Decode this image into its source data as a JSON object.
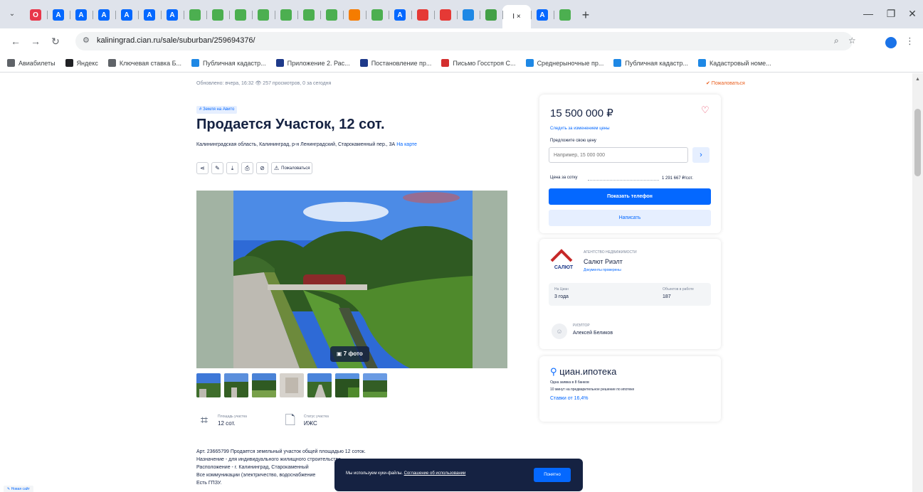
{
  "browser": {
    "tabs": [
      {
        "icon": "opera-icon",
        "letter": "O",
        "color": "#e8364a"
      },
      {
        "icon": "cian-tab-icon",
        "letter": "A",
        "color": "#0468ff"
      },
      {
        "icon": "cian-tab-icon",
        "letter": "A",
        "color": "#0468ff"
      },
      {
        "icon": "cian-tab-icon",
        "letter": "A",
        "color": "#0468ff"
      },
      {
        "icon": "cian-tab-icon",
        "letter": "A",
        "color": "#0468ff"
      },
      {
        "icon": "cian-tab-icon",
        "letter": "A",
        "color": "#0468ff"
      },
      {
        "icon": "cian-tab-icon",
        "letter": "A",
        "color": "#0468ff"
      },
      {
        "icon": "map-tab-icon",
        "letter": "",
        "color": "#4caf50"
      },
      {
        "icon": "map-tab-icon",
        "letter": "",
        "color": "#4caf50"
      },
      {
        "icon": "map-tab-icon",
        "letter": "",
        "color": "#4caf50"
      },
      {
        "icon": "map-tab-icon",
        "letter": "",
        "color": "#4caf50"
      },
      {
        "icon": "map-tab-icon",
        "letter": "",
        "color": "#4caf50"
      },
      {
        "icon": "map-tab-icon",
        "letter": "",
        "color": "#4caf50"
      },
      {
        "icon": "map-tab-icon",
        "letter": "",
        "color": "#4caf50"
      },
      {
        "icon": "orange-tab-icon",
        "letter": "",
        "color": "#f57c00"
      },
      {
        "icon": "map-tab-icon",
        "letter": "",
        "color": "#4caf50"
      },
      {
        "icon": "cian-tab-icon",
        "letter": "A",
        "color": "#0468ff"
      },
      {
        "icon": "flag-tab-icon",
        "letter": "",
        "color": "#e53935"
      },
      {
        "icon": "flag-tab-icon",
        "letter": "",
        "color": "#e53935"
      },
      {
        "icon": "sheet-tab-icon",
        "letter": "",
        "color": "#1e88e5"
      },
      {
        "icon": "green-check-tab-icon",
        "letter": "",
        "color": "#43a047"
      }
    ],
    "active_tab": {
      "label": "I",
      "close": "×"
    },
    "after_tabs": [
      {
        "icon": "cian-tab-icon",
        "letter": "A",
        "color": "#0468ff"
      },
      {
        "icon": "map-tab-icon",
        "letter": "",
        "color": "#4caf50"
      }
    ],
    "url": "kaliningrad.cian.ru/sale/suburban/259694376/",
    "bookmarks": [
      {
        "label": "Авиабилеты",
        "icon": "globe-icon",
        "color": "#5f6368"
      },
      {
        "label": "Яндекс",
        "icon": "yandex-icon",
        "color": "#202124"
      },
      {
        "label": "Ключевая ставка Б...",
        "icon": "bank-icon",
        "color": "#5f6368"
      },
      {
        "label": "Публичная кадастр...",
        "icon": "map-bookmark-icon",
        "color": "#1e88e5"
      },
      {
        "label": "Приложение 2. Рас...",
        "icon": "doc-icon",
        "color": "#1e3a8a"
      },
      {
        "label": "Постановление пр...",
        "icon": "doc-icon",
        "color": "#1e3a8a"
      },
      {
        "label": "Письмо Госстроя С...",
        "icon": "star-bookmark-icon",
        "color": "#d32f2f"
      },
      {
        "label": "Среднерыночные пр...",
        "icon": "gear-bookmark-icon",
        "color": "#1e88e5"
      },
      {
        "label": "Публичная кадастр...",
        "icon": "folder-icon",
        "color": "#1e88e5"
      },
      {
        "label": "Кадастровый номе...",
        "icon": "check-bookmark-icon",
        "color": "#1e88e5"
      }
    ]
  },
  "listing": {
    "meta": "Обновлено: вчера, 16:32   👁 257 просмотров, 0 за сегодня",
    "complaint": "✔ Пожаловаться",
    "badge": "# Земля на Авито",
    "title": "Продается Участок, 12 сот.",
    "address": "Калининградская область, Калининград, р-н Ленинградский, Старокаменный пер., 3А",
    "address_link": "На карте",
    "actions_label": "Пожаловаться",
    "photo_button": "▣ 7 фото",
    "props": [
      {
        "label": "Площадь участка",
        "value": "12 сот.",
        "icon": "area-icon"
      },
      {
        "label": "Статус участка",
        "value": "ИЖС",
        "icon": "status-doc-icon"
      }
    ],
    "description": [
      "Арт. 23665799 Продается земельный участок общей площадью 12 соток.",
      "Назначение - для индивидуального жилищного строительства",
      "Расположение - г. Калининград, Старокаменный",
      "Все коммуникации (электричество, водоснабжение",
      "Есть ГПЗУ."
    ]
  },
  "sidebar": {
    "price": "15 500 000 ₽",
    "follow": "Следить за изменением цены",
    "offer_label": "Предложите свою цену",
    "offer_placeholder": "Например, 15 000 000",
    "per_are_label": "Цена за сотку",
    "per_are_value": "1 291 667 ₽/сот.",
    "phone_button": "Показать телефон",
    "write_button": "Написать",
    "agency_type": "АГЕНТСТВО НЕДВИЖИМОСТИ",
    "agency_name": "Салют Риэлт",
    "agency_logo_text": "САЛЮТ",
    "agency_docs": "Документы проверены",
    "stats": [
      {
        "label": "На Циан",
        "value": "3 года"
      },
      {
        "label": "Объектов в работе",
        "value": "187"
      }
    ],
    "realtor_role": "РИЭЛТОР",
    "realtor_name": "Алексей Беликов",
    "mortgage_brand": "циан.ипотека",
    "mortgage_l1": "Одна заявка в 8 банков",
    "mortgage_l2": "10 минут на предварительное решение по ипотеке",
    "mortgage_rate": "Ставки от 16,4%"
  },
  "cookie": {
    "text": "Мы используем куки-файлы.",
    "link": "Соглашение об использовании",
    "ok": "Понятно"
  },
  "feedback": "✎ Новая сайт"
}
